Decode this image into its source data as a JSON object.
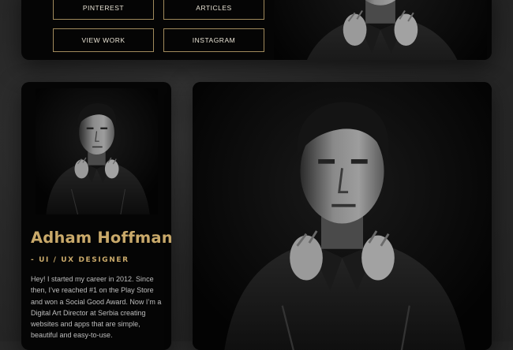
{
  "top_card": {
    "buttons": [
      "PINTEREST",
      "ARTICLES",
      "VIEW WORK",
      "INSTAGRAM"
    ]
  },
  "profile": {
    "name": "Adham Hoffman",
    "role": "- UI / UX DESIGNER",
    "bio": "Hey! I started my career in 2012. Since then, I’ve reached #1 on the Play Store and won a Social Good Award. Now I’m a Digital Art Director at Serbia creating websites and apps that are simple, beautiful and easy-to-use."
  },
  "colors": {
    "accent_gold": "#c9a96a",
    "card_bg": "#050505",
    "page_bg": "#2a2a2a",
    "button_border": "#a08a5c"
  }
}
